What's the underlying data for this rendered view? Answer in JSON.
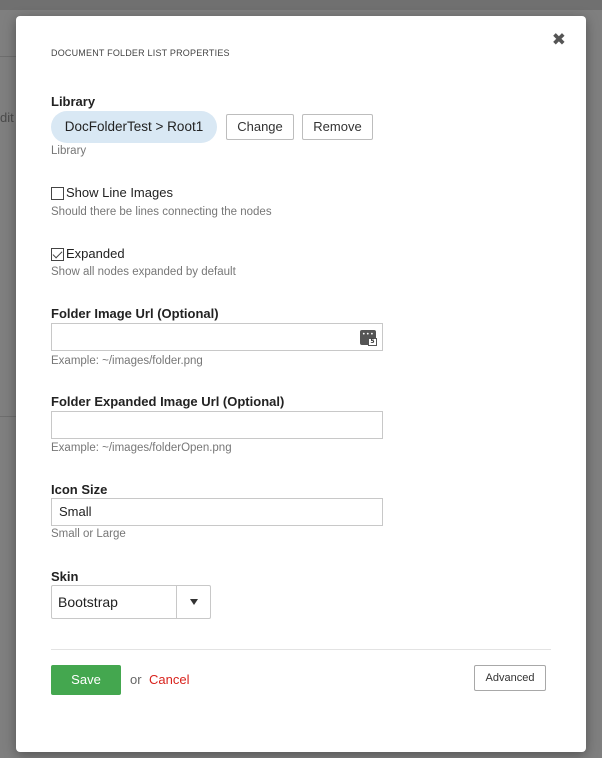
{
  "background": {
    "edit_text": "dit"
  },
  "modal": {
    "title": "DOCUMENT FOLDER LIST PROPERTIES",
    "close_icon": "close-icon"
  },
  "library": {
    "label": "Library",
    "value": "DocFolderTest > Root1",
    "change_label": "Change",
    "remove_label": "Remove",
    "help": "Library"
  },
  "show_line_images": {
    "label": "Show Line Images",
    "checked": false,
    "help": "Should there be lines connecting the nodes"
  },
  "expanded": {
    "label": "Expanded",
    "checked": true,
    "help": "Show all nodes expanded by default"
  },
  "folder_image_url": {
    "label": "Folder Image Url (Optional)",
    "value": "",
    "help": "Example: ~/images/folder.png",
    "icon": "password-manager-icon"
  },
  "folder_expanded_image_url": {
    "label": "Folder Expanded Image Url (Optional)",
    "value": "",
    "help": "Example: ~/images/folderOpen.png"
  },
  "icon_size": {
    "label": "Icon Size",
    "value": "Small",
    "help": "Small or Large"
  },
  "skin": {
    "label": "Skin",
    "selected": "Bootstrap"
  },
  "footer": {
    "save_label": "Save",
    "or_text": "or",
    "cancel_label": "Cancel",
    "advanced_label": "Advanced"
  },
  "colors": {
    "save_green": "#44a74f",
    "cancel_red": "#d9231d",
    "pill_blue": "#d9e8f4"
  }
}
